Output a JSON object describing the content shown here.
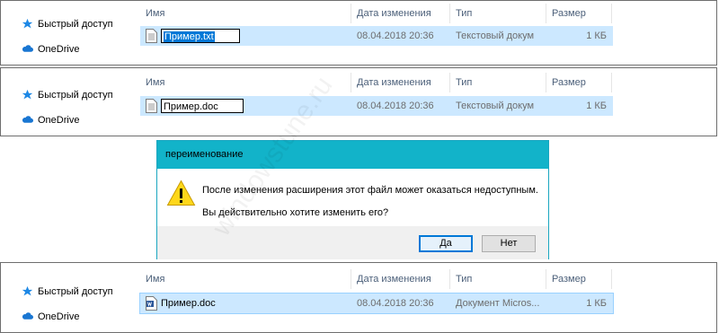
{
  "nav": {
    "quick_access": "Быстрый доступ",
    "onedrive": "OneDrive"
  },
  "columns": {
    "name": "Имя",
    "date": "Дата изменения",
    "type": "Тип",
    "size": "Размер"
  },
  "panels": [
    {
      "file_name": "Пример.txt",
      "date": "08.04.2018 20:36",
      "type": "Текстовый докум",
      "size": "1 КБ"
    },
    {
      "file_name": "Пример.doc",
      "date": "08.04.2018 20:36",
      "type": "Текстовый докум",
      "size": "1 КБ"
    },
    {
      "file_name": "Пример.doc",
      "date": "08.04.2018 20:36",
      "type": "Документ Micros...",
      "size": "1 КБ"
    }
  ],
  "dialog": {
    "title": "переименование",
    "message1": "После изменения расширения этот файл может оказаться недоступным.",
    "message2": "Вы действительно хотите изменить его?",
    "yes": "Да",
    "no": "Нет"
  },
  "watermark": "windowstune.ru",
  "colors": {
    "selection": "#cce8ff",
    "dialog_title": "#12b3c9",
    "header_text": "#4c607a",
    "text_selection": "#0078d7"
  }
}
